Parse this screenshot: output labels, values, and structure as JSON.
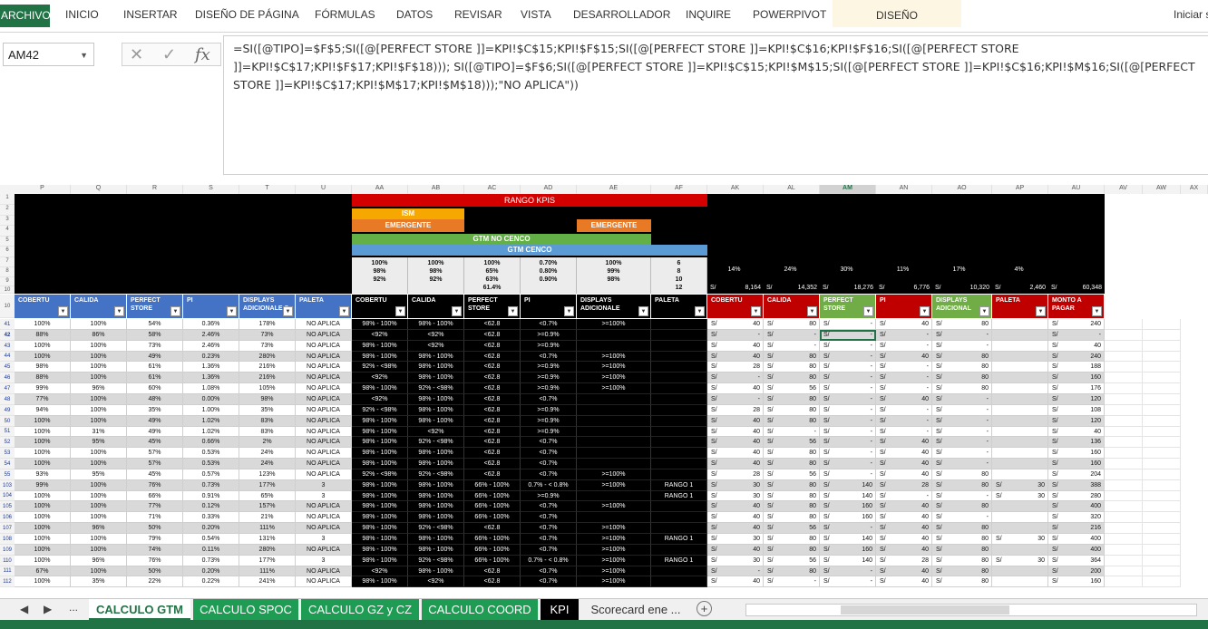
{
  "ribbon": {
    "tabs": [
      "ARCHIVO",
      "INICIO",
      "INSERTAR",
      "DISEÑO DE PÁGINA",
      "FÓRMULAS",
      "DATOS",
      "REVISAR",
      "VISTA",
      "DESARROLLADOR",
      "INQUIRE",
      "POWERPIVOT",
      "DISEÑO"
    ],
    "signin": "Iniciar s"
  },
  "formula_bar": {
    "name_box": "AM42",
    "cancel_icon": "✕",
    "confirm_icon": "✓",
    "fx_icon": "fx",
    "formula": "=SI([@TIPO]=$F$5;SI([@[PERFECT STORE ]]=KPI!$C$15;KPI!$F$15;SI([@[PERFECT STORE ]]=KPI!$C$16;KPI!$F$16;SI([@[PERFECT STORE ]]=KPI!$C$17;KPI!$F$17;KPI!$F$18))); SI([@TIPO]=$F$6;SI([@[PERFECT STORE ]]=KPI!$C$15;KPI!$M$15;SI([@[PERFECT STORE ]]=KPI!$C$16;KPI!$M$16;SI([@[PERFECT STORE ]]=KPI!$C$17;KPI!$M$17;KPI!$M$18)));\"NO APLICA\"))"
  },
  "columns": [
    "P",
    "Q",
    "R",
    "S",
    "T",
    "U",
    "AA",
    "AB",
    "AC",
    "AD",
    "AE",
    "AF",
    "AK",
    "AL",
    "AM",
    "AN",
    "AO",
    "AP",
    "AU",
    "AV",
    "AW",
    "AX"
  ],
  "top_rows": [
    "1",
    "2",
    "3",
    "4",
    "5",
    "6",
    "7",
    "8",
    "9",
    "10"
  ],
  "bands": {
    "rango": "RANGO KPIS",
    "ism": "ISM",
    "emergente1": "EMERGENTE",
    "emergente2": "EMERGENTE",
    "gtm_no_cenco": "GTM NO CENCO",
    "gtm_cenco": "GTM CENCO"
  },
  "thresholds": {
    "AA": [
      "100%",
      "98%",
      "92%"
    ],
    "AB": [
      "100%",
      "98%",
      "92%"
    ],
    "AC": [
      "100%",
      "65%",
      "63%",
      "61.4%"
    ],
    "AD": [
      "0.70%",
      "0.80%",
      "0.90%"
    ],
    "AE": [
      "100%",
      "99%",
      "98%"
    ],
    "AF": [
      "6",
      "8",
      "10",
      "12"
    ]
  },
  "summary": {
    "AK_pct": "14%",
    "AL_pct": "24%",
    "AM_pct": "30%",
    "AN_pct": "11%",
    "AO_pct": "17%",
    "AP_pct": "4%",
    "AK": "8,164",
    "AL": "14,352",
    "AM": "18,276",
    "AN": "6,776",
    "AO": "10,320",
    "AP": "2,460",
    "AU": "60,348",
    "cur": "S/"
  },
  "headers": {
    "left": [
      "COBERTU",
      "CALIDA",
      "PERFECT STORE",
      "PI",
      "DISPLAYS ADICIONALE S",
      "PALETA"
    ],
    "mid": [
      "COBERTU",
      "CALIDA",
      "PERFECT STORE",
      "PI",
      "DISPLAYS ADICIONALE",
      "PALETA"
    ],
    "right": [
      "COBERTU",
      "CALIDA",
      "PERFECT STORE",
      "PI",
      "DISPLAYS ADICIONAL",
      "PALETA",
      "MONTO A PAGAR"
    ]
  },
  "rows": [
    {
      "n": "41",
      "p": "100%",
      "q": "100%",
      "r": "54%",
      "s": "0.36%",
      "t": "178%",
      "u": "NO APLICA",
      "aa": "98% - 100%",
      "ab": "98% - 100%",
      "ac": "<62.8",
      "ad": "<0.7%",
      "ae": ">=100%",
      "af": "",
      "ak": "40",
      "al": "80",
      "am": "-",
      "an": "40",
      "ao": "80",
      "ap": "",
      "au": "240"
    },
    {
      "n": "42",
      "p": "88%",
      "q": "86%",
      "r": "58%",
      "s": "2.46%",
      "t": "73%",
      "u": "NO APLICA",
      "aa": "<92%",
      "ab": "<92%",
      "ac": "<62.8",
      "ad": ">=0.9%",
      "ae": "",
      "af": "",
      "ak": "-",
      "al": "-",
      "am": "-",
      "an": "-",
      "ao": "-",
      "ap": "",
      "au": "-"
    },
    {
      "n": "43",
      "p": "100%",
      "q": "100%",
      "r": "73%",
      "s": "2.46%",
      "t": "73%",
      "u": "NO APLICA",
      "aa": "98% - 100%",
      "ab": "<92%",
      "ac": "<62.8",
      "ad": ">=0.9%",
      "ae": "",
      "af": "",
      "ak": "40",
      "al": "-",
      "am": "-",
      "an": "-",
      "ao": "-",
      "ap": "",
      "au": "40"
    },
    {
      "n": "44",
      "p": "100%",
      "q": "100%",
      "r": "49%",
      "s": "0.23%",
      "t": "280%",
      "u": "NO APLICA",
      "aa": "98% - 100%",
      "ab": "98% - 100%",
      "ac": "<62.8",
      "ad": "<0.7%",
      "ae": ">=100%",
      "af": "",
      "ak": "40",
      "al": "80",
      "am": "-",
      "an": "40",
      "ao": "80",
      "ap": "",
      "au": "240"
    },
    {
      "n": "45",
      "p": "98%",
      "q": "100%",
      "r": "61%",
      "s": "1.36%",
      "t": "216%",
      "u": "NO APLICA",
      "aa": "92% - <98%",
      "ab": "98% - 100%",
      "ac": "<62.8",
      "ad": ">=0.9%",
      "ae": ">=100%",
      "af": "",
      "ak": "28",
      "al": "80",
      "am": "-",
      "an": "-",
      "ao": "80",
      "ap": "",
      "au": "188"
    },
    {
      "n": "46",
      "p": "88%",
      "q": "100%",
      "r": "61%",
      "s": "1.36%",
      "t": "216%",
      "u": "NO APLICA",
      "aa": "<92%",
      "ab": "98% - 100%",
      "ac": "<62.8",
      "ad": ">=0.9%",
      "ae": ">=100%",
      "af": "",
      "ak": "-",
      "al": "80",
      "am": "-",
      "an": "-",
      "ao": "80",
      "ap": "",
      "au": "160"
    },
    {
      "n": "47",
      "p": "99%",
      "q": "96%",
      "r": "60%",
      "s": "1.08%",
      "t": "105%",
      "u": "NO APLICA",
      "aa": "98% - 100%",
      "ab": "92% - <98%",
      "ac": "<62.8",
      "ad": ">=0.9%",
      "ae": ">=100%",
      "af": "",
      "ak": "40",
      "al": "56",
      "am": "-",
      "an": "-",
      "ao": "80",
      "ap": "",
      "au": "176"
    },
    {
      "n": "48",
      "p": "77%",
      "q": "100%",
      "r": "48%",
      "s": "0.00%",
      "t": "98%",
      "u": "NO APLICA",
      "aa": "<92%",
      "ab": "98% - 100%",
      "ac": "<62.8",
      "ad": "<0.7%",
      "ae": "",
      "af": "",
      "ak": "-",
      "al": "80",
      "am": "-",
      "an": "40",
      "ao": "-",
      "ap": "",
      "au": "120"
    },
    {
      "n": "49",
      "p": "94%",
      "q": "100%",
      "r": "35%",
      "s": "1.00%",
      "t": "35%",
      "u": "NO APLICA",
      "aa": "92% - <98%",
      "ab": "98% - 100%",
      "ac": "<62.8",
      "ad": ">=0.9%",
      "ae": "",
      "af": "",
      "ak": "28",
      "al": "80",
      "am": "-",
      "an": "-",
      "ao": "-",
      "ap": "",
      "au": "108"
    },
    {
      "n": "50",
      "p": "100%",
      "q": "100%",
      "r": "49%",
      "s": "1.02%",
      "t": "83%",
      "u": "NO APLICA",
      "aa": "98% - 100%",
      "ab": "98% - 100%",
      "ac": "<62.8",
      "ad": ">=0.9%",
      "ae": "",
      "af": "",
      "ak": "40",
      "al": "80",
      "am": "-",
      "an": "-",
      "ao": "-",
      "ap": "",
      "au": "120"
    },
    {
      "n": "51",
      "p": "100%",
      "q": "31%",
      "r": "49%",
      "s": "1.02%",
      "t": "83%",
      "u": "NO APLICA",
      "aa": "98% - 100%",
      "ab": "<92%",
      "ac": "<62.8",
      "ad": ">=0.9%",
      "ae": "",
      "af": "",
      "ak": "40",
      "al": "-",
      "am": "-",
      "an": "-",
      "ao": "-",
      "ap": "",
      "au": "40"
    },
    {
      "n": "52",
      "p": "100%",
      "q": "95%",
      "r": "45%",
      "s": "0.66%",
      "t": "2%",
      "u": "NO APLICA",
      "aa": "98% - 100%",
      "ab": "92% - <98%",
      "ac": "<62.8",
      "ad": "<0.7%",
      "ae": "",
      "af": "",
      "ak": "40",
      "al": "56",
      "am": "-",
      "an": "40",
      "ao": "-",
      "ap": "",
      "au": "136"
    },
    {
      "n": "53",
      "p": "100%",
      "q": "100%",
      "r": "57%",
      "s": "0.53%",
      "t": "24%",
      "u": "NO APLICA",
      "aa": "98% - 100%",
      "ab": "98% - 100%",
      "ac": "<62.8",
      "ad": "<0.7%",
      "ae": "",
      "af": "",
      "ak": "40",
      "al": "80",
      "am": "-",
      "an": "40",
      "ao": "-",
      "ap": "",
      "au": "160"
    },
    {
      "n": "54",
      "p": "100%",
      "q": "100%",
      "r": "57%",
      "s": "0.53%",
      "t": "24%",
      "u": "NO APLICA",
      "aa": "98% - 100%",
      "ab": "98% - 100%",
      "ac": "<62.8",
      "ad": "<0.7%",
      "ae": "",
      "af": "",
      "ak": "40",
      "al": "80",
      "am": "-",
      "an": "40",
      "ao": "-",
      "ap": "",
      "au": "160"
    },
    {
      "n": "55",
      "p": "93%",
      "q": "95%",
      "r": "45%",
      "s": "0.57%",
      "t": "123%",
      "u": "NO APLICA",
      "aa": "92% - <98%",
      "ab": "92% - <98%",
      "ac": "<62.8",
      "ad": "<0.7%",
      "ae": ">=100%",
      "af": "",
      "ak": "28",
      "al": "56",
      "am": "-",
      "an": "40",
      "ao": "80",
      "ap": "",
      "au": "204"
    },
    {
      "n": "103",
      "p": "99%",
      "q": "100%",
      "r": "76%",
      "s": "0.73%",
      "t": "177%",
      "u": "3",
      "aa": "98% - 100%",
      "ab": "98% - 100%",
      "ac": "66% - 100%",
      "ad": "0.7% - < 0.8%",
      "ae": ">=100%",
      "af": "RANGO 1",
      "ak": "30",
      "al": "80",
      "am": "140",
      "an": "28",
      "ao": "80",
      "ap": "30",
      "au": "388"
    },
    {
      "n": "104",
      "p": "100%",
      "q": "100%",
      "r": "66%",
      "s": "0.91%",
      "t": "65%",
      "u": "3",
      "aa": "98% - 100%",
      "ab": "98% - 100%",
      "ac": "66% - 100%",
      "ad": ">=0.9%",
      "ae": "",
      "af": "RANGO 1",
      "ak": "30",
      "al": "80",
      "am": "140",
      "an": "-",
      "ao": "-",
      "ap": "30",
      "au": "280"
    },
    {
      "n": "105",
      "p": "100%",
      "q": "100%",
      "r": "77%",
      "s": "0.12%",
      "t": "157%",
      "u": "NO APLICA",
      "aa": "98% - 100%",
      "ab": "98% - 100%",
      "ac": "66% - 100%",
      "ad": "<0.7%",
      "ae": ">=100%",
      "af": "",
      "ak": "40",
      "al": "80",
      "am": "160",
      "an": "40",
      "ao": "80",
      "ap": "",
      "au": "400"
    },
    {
      "n": "106",
      "p": "100%",
      "q": "100%",
      "r": "71%",
      "s": "0.33%",
      "t": "21%",
      "u": "NO APLICA",
      "aa": "98% - 100%",
      "ab": "98% - 100%",
      "ac": "66% - 100%",
      "ad": "<0.7%",
      "ae": "",
      "af": "",
      "ak": "40",
      "al": "80",
      "am": "160",
      "an": "40",
      "ao": "-",
      "ap": "",
      "au": "320"
    },
    {
      "n": "107",
      "p": "100%",
      "q": "96%",
      "r": "50%",
      "s": "0.20%",
      "t": "111%",
      "u": "NO APLICA",
      "aa": "98% - 100%",
      "ab": "92% - <98%",
      "ac": "<62.8",
      "ad": "<0.7%",
      "ae": ">=100%",
      "af": "",
      "ak": "40",
      "al": "56",
      "am": "-",
      "an": "40",
      "ao": "80",
      "ap": "",
      "au": "216"
    },
    {
      "n": "108",
      "p": "100%",
      "q": "100%",
      "r": "79%",
      "s": "0.54%",
      "t": "131%",
      "u": "3",
      "aa": "98% - 100%",
      "ab": "98% - 100%",
      "ac": "66% - 100%",
      "ad": "<0.7%",
      "ae": ">=100%",
      "af": "RANGO 1",
      "ak": "30",
      "al": "80",
      "am": "140",
      "an": "40",
      "ao": "80",
      "ap": "30",
      "au": "400"
    },
    {
      "n": "109",
      "p": "100%",
      "q": "100%",
      "r": "74%",
      "s": "0.11%",
      "t": "280%",
      "u": "NO APLICA",
      "aa": "98% - 100%",
      "ab": "98% - 100%",
      "ac": "66% - 100%",
      "ad": "<0.7%",
      "ae": ">=100%",
      "af": "",
      "ak": "40",
      "al": "80",
      "am": "160",
      "an": "40",
      "ao": "80",
      "ap": "",
      "au": "400"
    },
    {
      "n": "110",
      "p": "100%",
      "q": "96%",
      "r": "76%",
      "s": "0.73%",
      "t": "177%",
      "u": "3",
      "aa": "98% - 100%",
      "ab": "92% - <98%",
      "ac": "66% - 100%",
      "ad": "0.7% - < 0.8%",
      "ae": ">=100%",
      "af": "RANGO 1",
      "ak": "30",
      "al": "56",
      "am": "140",
      "an": "28",
      "ao": "80",
      "ap": "30",
      "au": "364"
    },
    {
      "n": "111",
      "p": "67%",
      "q": "100%",
      "r": "50%",
      "s": "0.20%",
      "t": "111%",
      "u": "NO APLICA",
      "aa": "<92%",
      "ab": "98% - 100%",
      "ac": "<62.8",
      "ad": "<0.7%",
      "ae": ">=100%",
      "af": "",
      "ak": "-",
      "al": "80",
      "am": "-",
      "an": "40",
      "ao": "80",
      "ap": "",
      "au": "200"
    },
    {
      "n": "112",
      "p": "100%",
      "q": "35%",
      "r": "22%",
      "s": "0.22%",
      "t": "241%",
      "u": "NO APLICA",
      "aa": "98% - 100%",
      "ab": "<92%",
      "ac": "<62.8",
      "ad": "<0.7%",
      "ae": ">=100%",
      "af": "",
      "ak": "40",
      "al": "-",
      "am": "-",
      "an": "40",
      "ao": "80",
      "ap": "",
      "au": "160"
    }
  ],
  "sheet_tabs": [
    "CALCULO GTM",
    "CALCULO SPOC",
    "CALCULO GZ y CZ",
    "CALCULO COORD",
    "KPI",
    "Scorecard ene ..."
  ],
  "sheet_nav": {
    "prev": "◀",
    "next": "▶",
    "more": "...",
    "add": "+"
  }
}
